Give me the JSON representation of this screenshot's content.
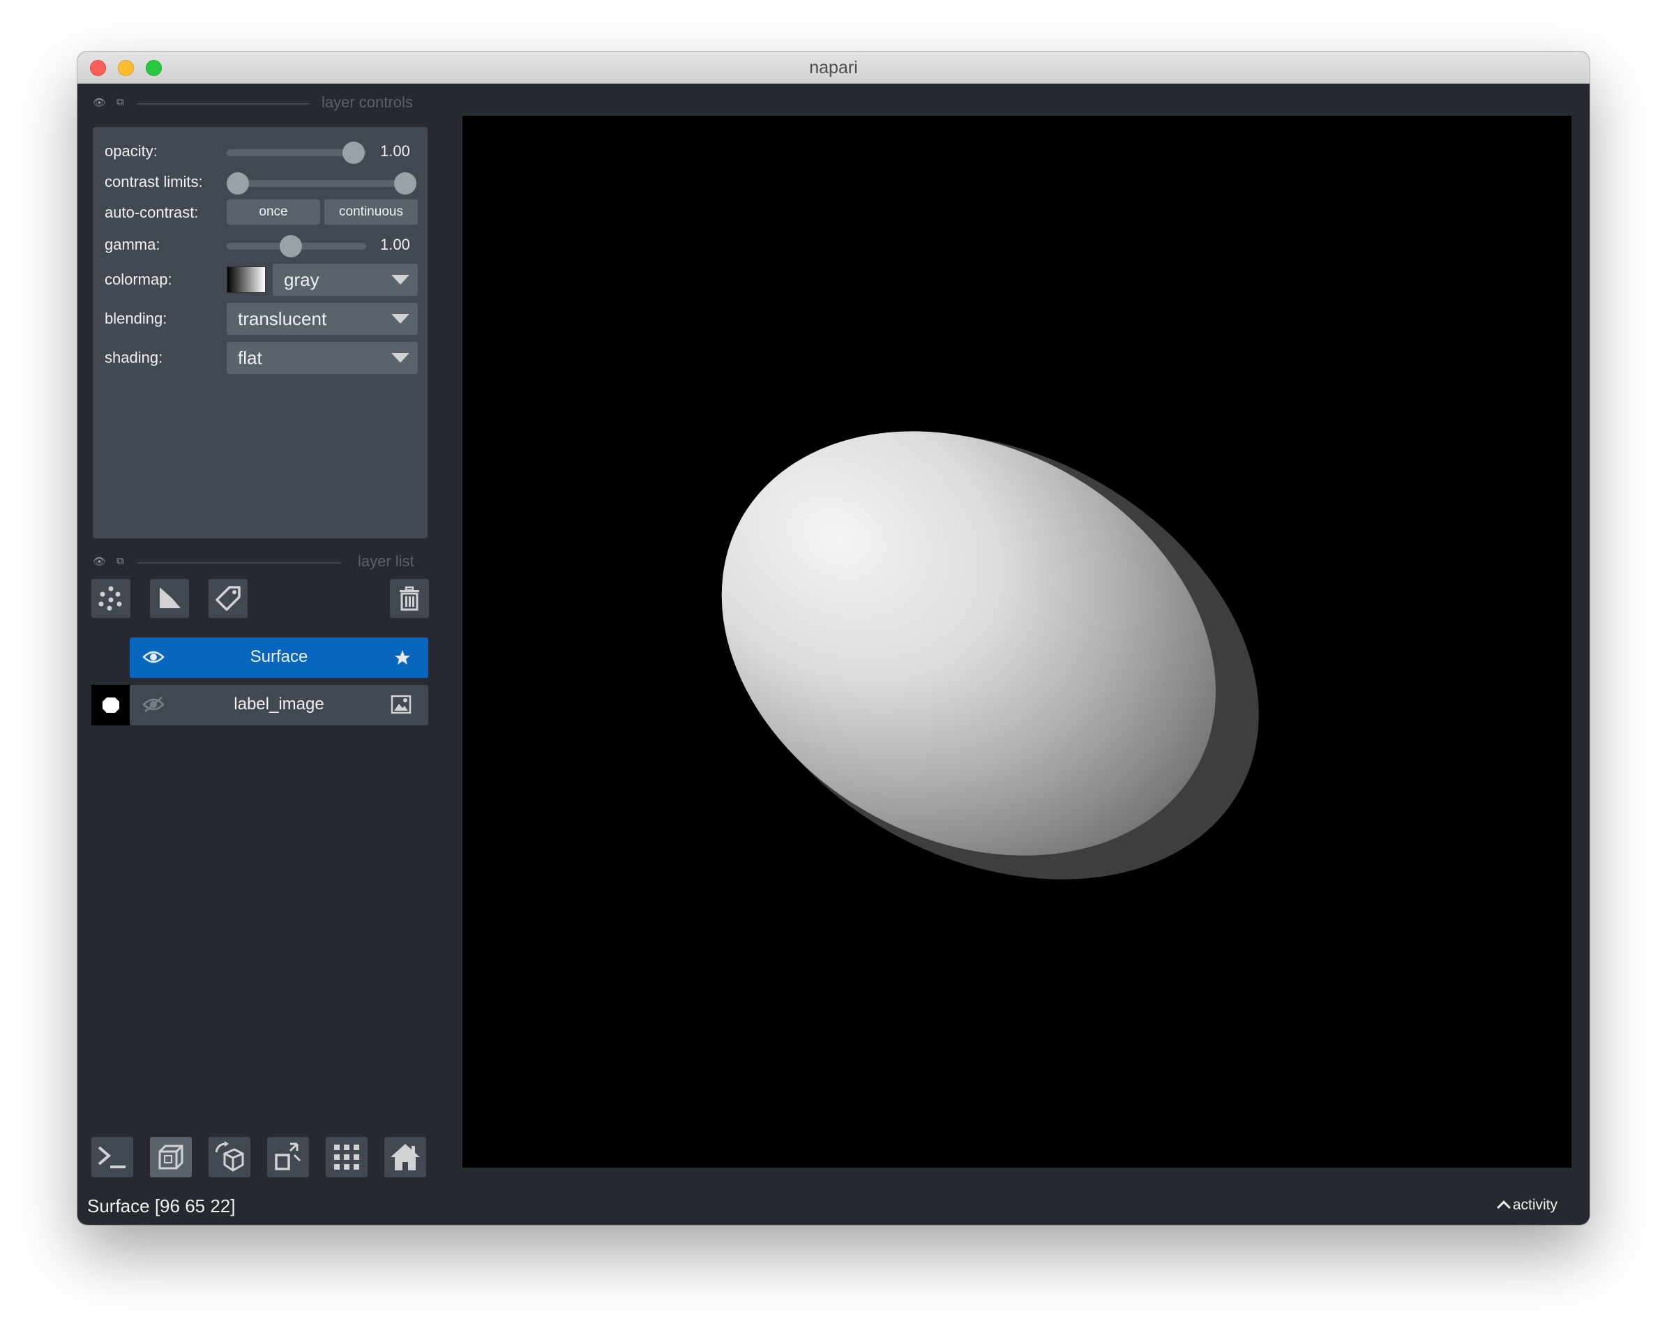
{
  "window": {
    "title": "napari"
  },
  "layer_controls": {
    "header": "layer controls",
    "opacity": {
      "label": "opacity:",
      "value": "1.00",
      "fraction": 1.0
    },
    "contrast_limits": {
      "label": "contrast limits:",
      "low_fraction": 0.0,
      "high_fraction": 1.0
    },
    "auto_contrast": {
      "label": "auto-contrast:",
      "once": "once",
      "continuous": "continuous"
    },
    "gamma": {
      "label": "gamma:",
      "value": "1.00",
      "fraction": 0.5
    },
    "colormap": {
      "label": "colormap:",
      "value": "gray"
    },
    "blending": {
      "label": "blending:",
      "value": "translucent"
    },
    "shading": {
      "label": "shading:",
      "value": "flat"
    }
  },
  "layer_list": {
    "header": "layer list",
    "layers": [
      {
        "name": "Surface",
        "selected": true,
        "visible": true,
        "type_icon": "star-icon"
      },
      {
        "name": "label_image",
        "selected": false,
        "visible": false,
        "type_icon": "image-icon"
      }
    ]
  },
  "toolbar_icons": [
    "new-points-icon",
    "new-shapes-icon",
    "new-labels-icon",
    "delete-layer-icon"
  ],
  "bottom_icons": [
    "console-icon",
    "ndisplay-icon",
    "roll-dims-icon",
    "transpose-icon",
    "grid-icon",
    "home-icon"
  ],
  "status": {
    "text": "Surface [96 65 22]",
    "activity": "activity"
  },
  "colors": {
    "selected": "#0866bf",
    "panel": "#414851",
    "background": "#262930",
    "canvas": "#000000"
  }
}
